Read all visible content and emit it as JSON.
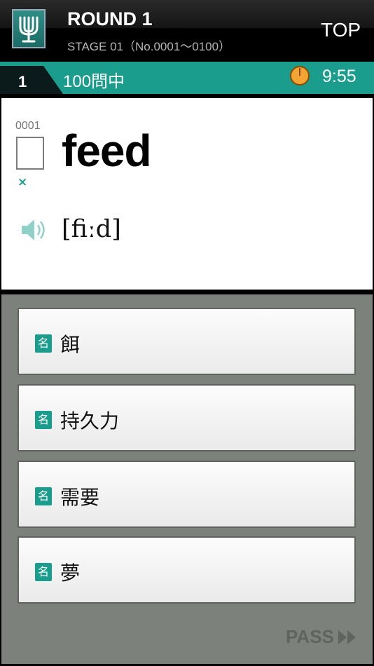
{
  "header": {
    "title": "ROUND 1",
    "stage": "STAGE 01（No.0001～0100）",
    "top_label": "TOP"
  },
  "progress": {
    "question_index": "1",
    "total_label": "100問中",
    "time_remaining": "9:55"
  },
  "word_card": {
    "number": "0001",
    "word": "feed",
    "result_mark": "×",
    "pronunciation": "[fiːd]"
  },
  "choices": [
    {
      "pos": "名",
      "meaning": "餌"
    },
    {
      "pos": "名",
      "meaning": "持久力"
    },
    {
      "pos": "名",
      "meaning": "需要"
    },
    {
      "pos": "名",
      "meaning": "夢"
    }
  ],
  "pass_label": "PASS",
  "colors": {
    "accent": "#1a9d8c",
    "timer": "#f4a433",
    "panel": "#7c817c"
  }
}
